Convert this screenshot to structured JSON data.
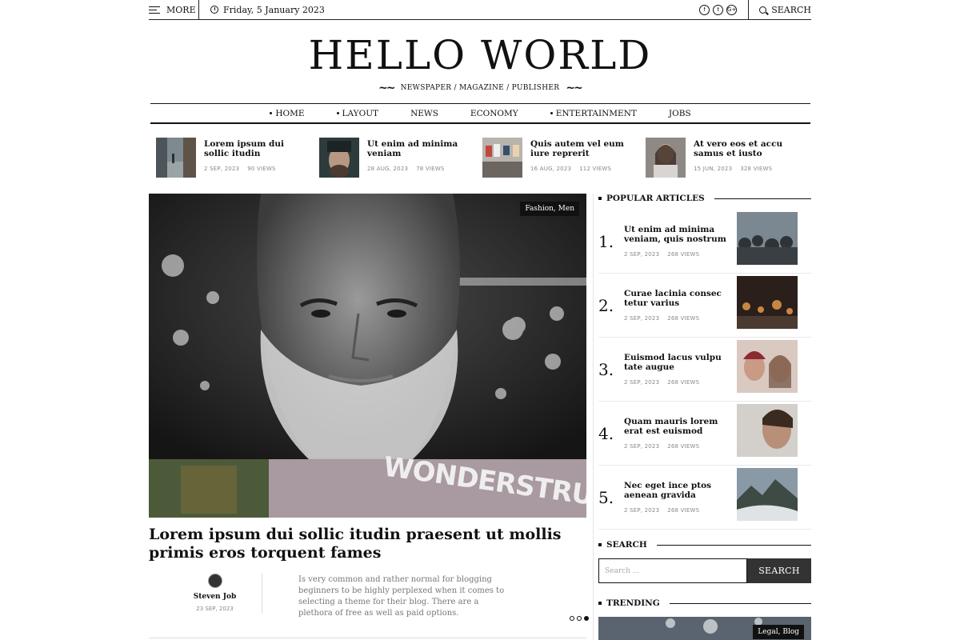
{
  "topbar": {
    "more_label": "MORE",
    "date": "Friday, 5 January 2023",
    "search_label": "SEARCH",
    "social": [
      "f",
      "t",
      "G+"
    ]
  },
  "masthead": {
    "title": "HELLO WORLD",
    "tagline": "NEWSPAPER / MAGAZINE / PUBLISHER"
  },
  "nav": {
    "items": [
      {
        "label": "HOME",
        "dot": true
      },
      {
        "label": "LAYOUT",
        "dot": true
      },
      {
        "label": "NEWS",
        "dot": false
      },
      {
        "label": "ECONOMY",
        "dot": false
      },
      {
        "label": "ENTERTAINMENT",
        "dot": true
      },
      {
        "label": "JOBS",
        "dot": false
      }
    ]
  },
  "ticker": [
    {
      "title": "Lorem ipsum dui sollic itudin",
      "date": "2 SEP, 2023",
      "views": "90 VIEWS"
    },
    {
      "title": "Ut enim ad minima veniam",
      "date": "28 AUG, 2023",
      "views": "78 VIEWS"
    },
    {
      "title": "Quis autem vel eum iure reprerit",
      "date": "16 AUG, 2023",
      "views": "112 VIEWS"
    },
    {
      "title": "At vero eos et accu samus et iusto",
      "date": "15 JUN, 2023",
      "views": "328 VIEWS"
    }
  ],
  "hero": {
    "tag": "Fashion, Men",
    "shirt_text": "WONDERSTRUCK",
    "title": "Lorem ipsum dui sollic itudin praesent ut mollis primis eros torquent fames",
    "author": "Steven Job",
    "date": "23 SEP, 2023",
    "excerpt": "Is very common and rather normal for blogging beginners to be highly perplexed when it comes to selecting a theme for their blog. There are a plethora of free as well as paid options."
  },
  "popular": {
    "heading": "POPULAR ARTICLES",
    "items": [
      {
        "num": "1.",
        "title": "Ut enim ad minima veniam, quis nostrum",
        "date": "2 SEP, 2023",
        "views": "268 VIEWS"
      },
      {
        "num": "2.",
        "title": "Curae lacinia consec tetur varius",
        "date": "2 SEP, 2023",
        "views": "268 VIEWS"
      },
      {
        "num": "3.",
        "title": "Euismod lacus vulpu tate augue",
        "date": "2 SEP, 2023",
        "views": "268 VIEWS"
      },
      {
        "num": "4.",
        "title": "Quam mauris lorem erat est euismod",
        "date": "2 SEP, 2023",
        "views": "268 VIEWS"
      },
      {
        "num": "5.",
        "title": "Nec eget ince ptos aenean gravida",
        "date": "2 SEP, 2023",
        "views": "268 VIEWS"
      }
    ]
  },
  "search_widget": {
    "heading": "SEARCH",
    "placeholder": "Search ...",
    "button": "SEARCH"
  },
  "trending": {
    "heading": "TRENDING",
    "tag": "Legal, Blog"
  }
}
